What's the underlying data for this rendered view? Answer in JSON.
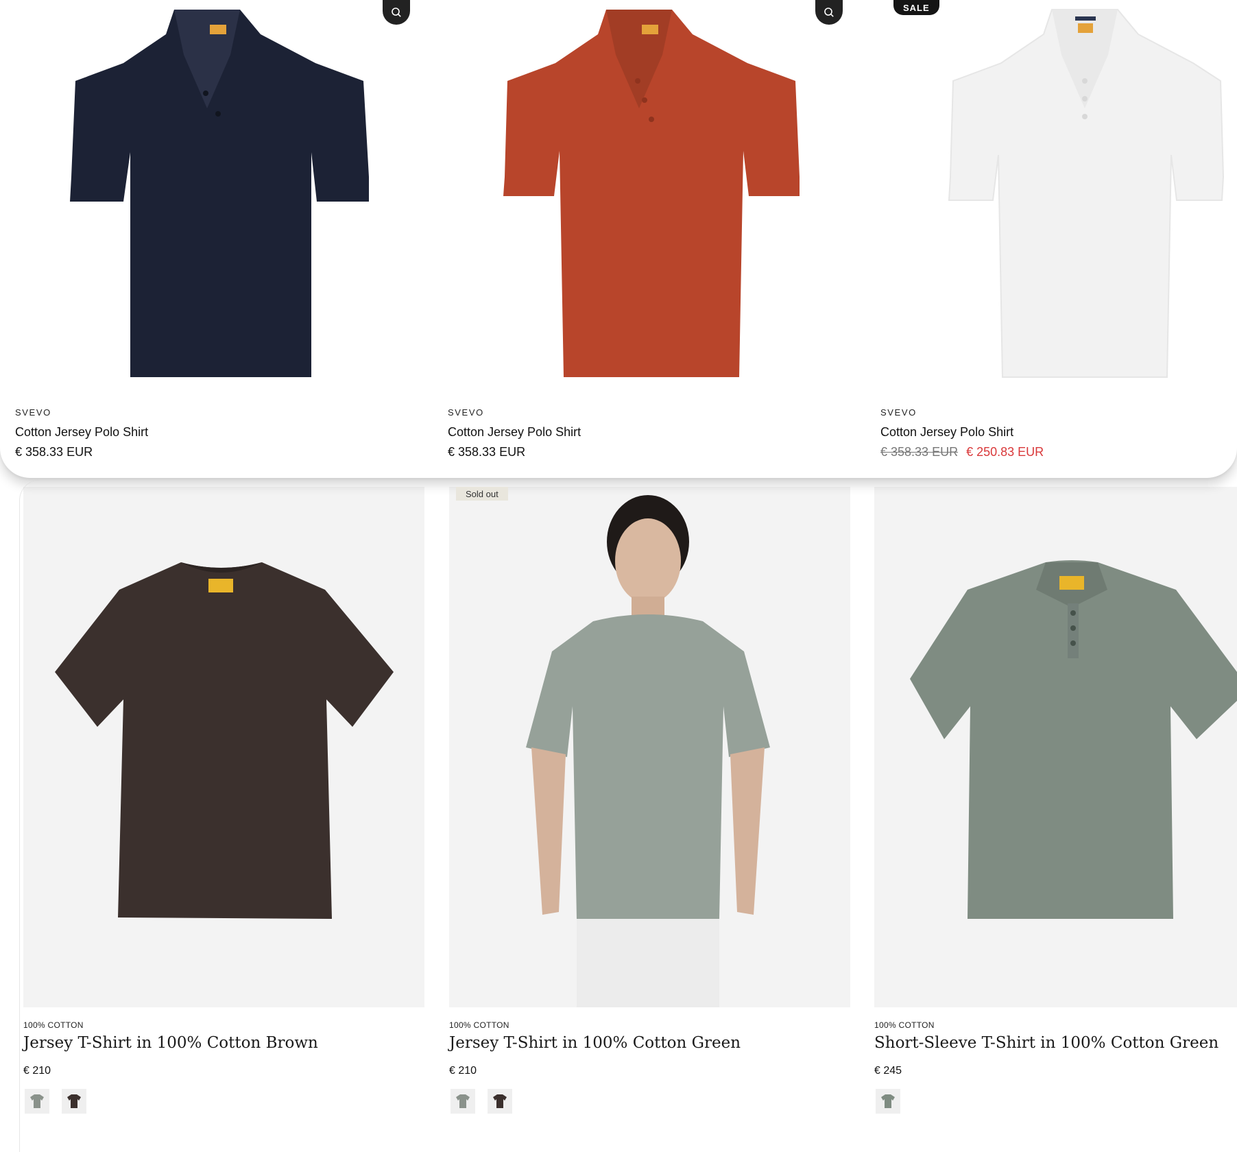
{
  "top_products": [
    {
      "brand": "SVEVO",
      "title": "Cotton Jersey Polo Shirt",
      "price": "€ 358.33 EUR",
      "color": "#1c2235",
      "has_zoom": true
    },
    {
      "brand": "SVEVO",
      "title": "Cotton Jersey Polo Shirt",
      "price": "€ 358.33 EUR",
      "color": "#b8452b",
      "has_zoom": true
    },
    {
      "brand": "SVEVO",
      "title": "Cotton Jersey Polo Shirt",
      "badge": "SALE",
      "old_price": "€ 358.33 EUR",
      "sale_price": "€ 250.83 EUR",
      "color": "#f2f2f2"
    }
  ],
  "bottom_products": [
    {
      "tag": "100% COTTON",
      "title": "Jersey T-Shirt in 100% Cotton Brown",
      "price": "€ 210",
      "color": "#3b302d",
      "swatches": [
        "#8a928b",
        "#3b302d"
      ]
    },
    {
      "tag": "100% COTTON",
      "title": "Jersey T-Shirt in 100% Cotton Green",
      "price": "€ 210",
      "badge": "Sold out",
      "color": "#96a199",
      "swatches": [
        "#8a928b",
        "#3b302d"
      ]
    },
    {
      "tag": "100% COTTON",
      "title": "Short-Sleeve T-Shirt in 100% Cotton Green",
      "price": "€ 245",
      "color": "#7f8c82",
      "swatches": [
        "#7f8c82"
      ]
    }
  ],
  "icons": {
    "zoom": "magnifier-icon",
    "garment": "shirt-icon"
  },
  "colors": {
    "sale_red": "#d9383a",
    "label_yellow": "#e9b52a"
  }
}
